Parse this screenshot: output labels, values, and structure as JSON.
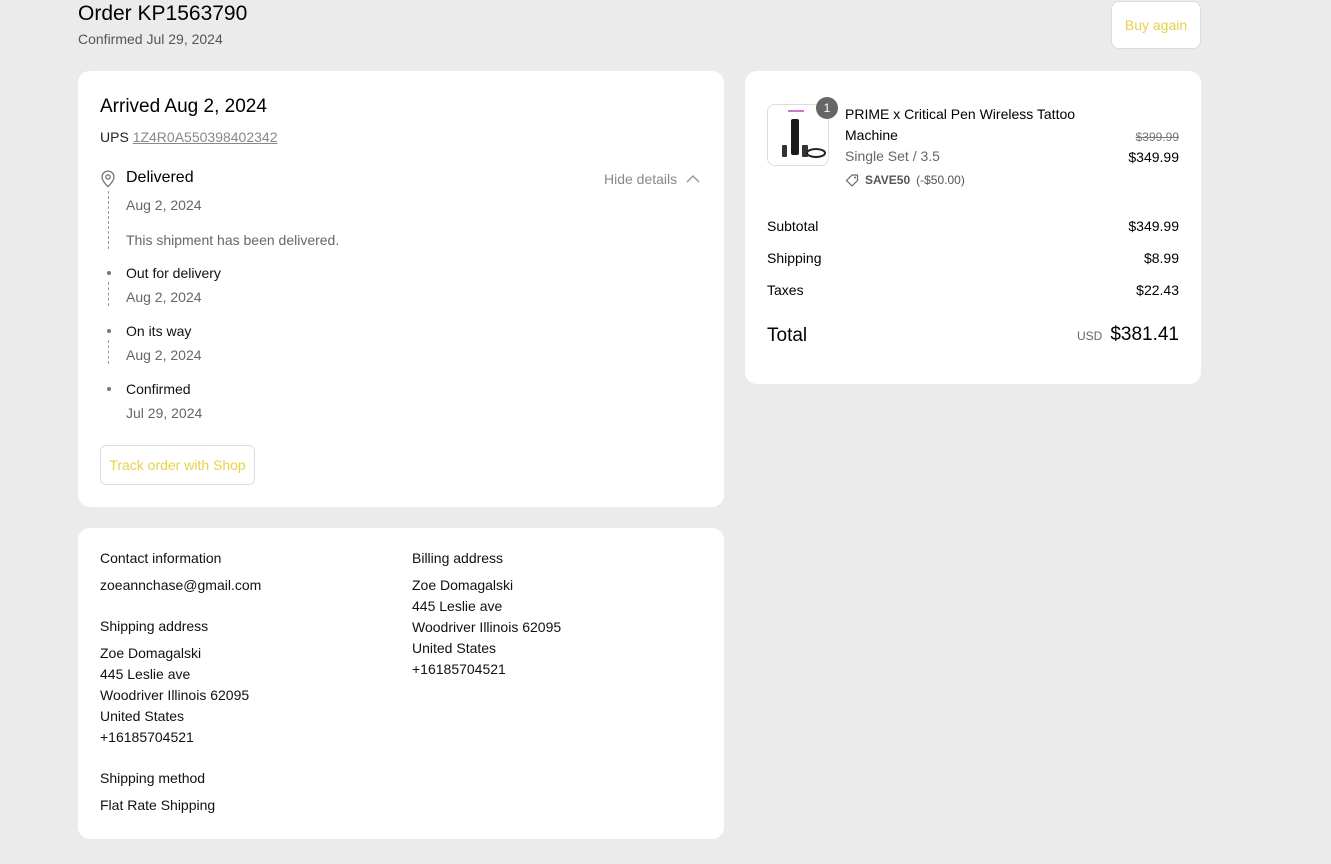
{
  "header": {
    "order_title": "Order KP1563790",
    "confirmed": "Confirmed Jul 29, 2024",
    "buy_again": "Buy again"
  },
  "shipment": {
    "arrived": "Arrived Aug 2, 2024",
    "carrier": "UPS",
    "tracking": "1Z4R0A550398402342",
    "hide_details": "Hide details",
    "current": {
      "title": "Delivered",
      "date": "Aug 2, 2024",
      "message": "This shipment has been delivered."
    },
    "steps": [
      {
        "title": "Out for delivery",
        "date": "Aug 2, 2024"
      },
      {
        "title": "On its way",
        "date": "Aug 2, 2024"
      },
      {
        "title": "Confirmed",
        "date": "Jul 29, 2024"
      }
    ],
    "track_button": "Track order with Shop"
  },
  "info": {
    "contact_heading": "Contact information",
    "contact_email": "zoeannchase@gmail.com",
    "shipping_heading": "Shipping address",
    "shipping_address": [
      "Zoe Domagalski",
      "445 Leslie ave",
      "Woodriver Illinois 62095",
      "United States",
      "+16185704521"
    ],
    "method_heading": "Shipping method",
    "method": "Flat Rate Shipping",
    "billing_heading": "Billing address",
    "billing_address": [
      "Zoe Domagalski",
      "445 Leslie ave",
      "Woodriver Illinois 62095",
      "United States",
      "+16185704521"
    ]
  },
  "summary": {
    "item": {
      "quantity": "1",
      "name": "PRIME x Critical Pen Wireless Tattoo Machine",
      "variant": "Single Set / 3.5",
      "discount_code": "SAVE50",
      "discount_amount": "(-$50.00)",
      "original_price": "$399.99",
      "price": "$349.99"
    },
    "subtotal_label": "Subtotal",
    "subtotal": "$349.99",
    "shipping_label": "Shipping",
    "shipping": "$8.99",
    "taxes_label": "Taxes",
    "taxes": "$22.43",
    "total_label": "Total",
    "currency": "USD",
    "total": "$381.41"
  },
  "colors": {
    "accent": "#e6d24a",
    "background": "#ebebeb"
  }
}
